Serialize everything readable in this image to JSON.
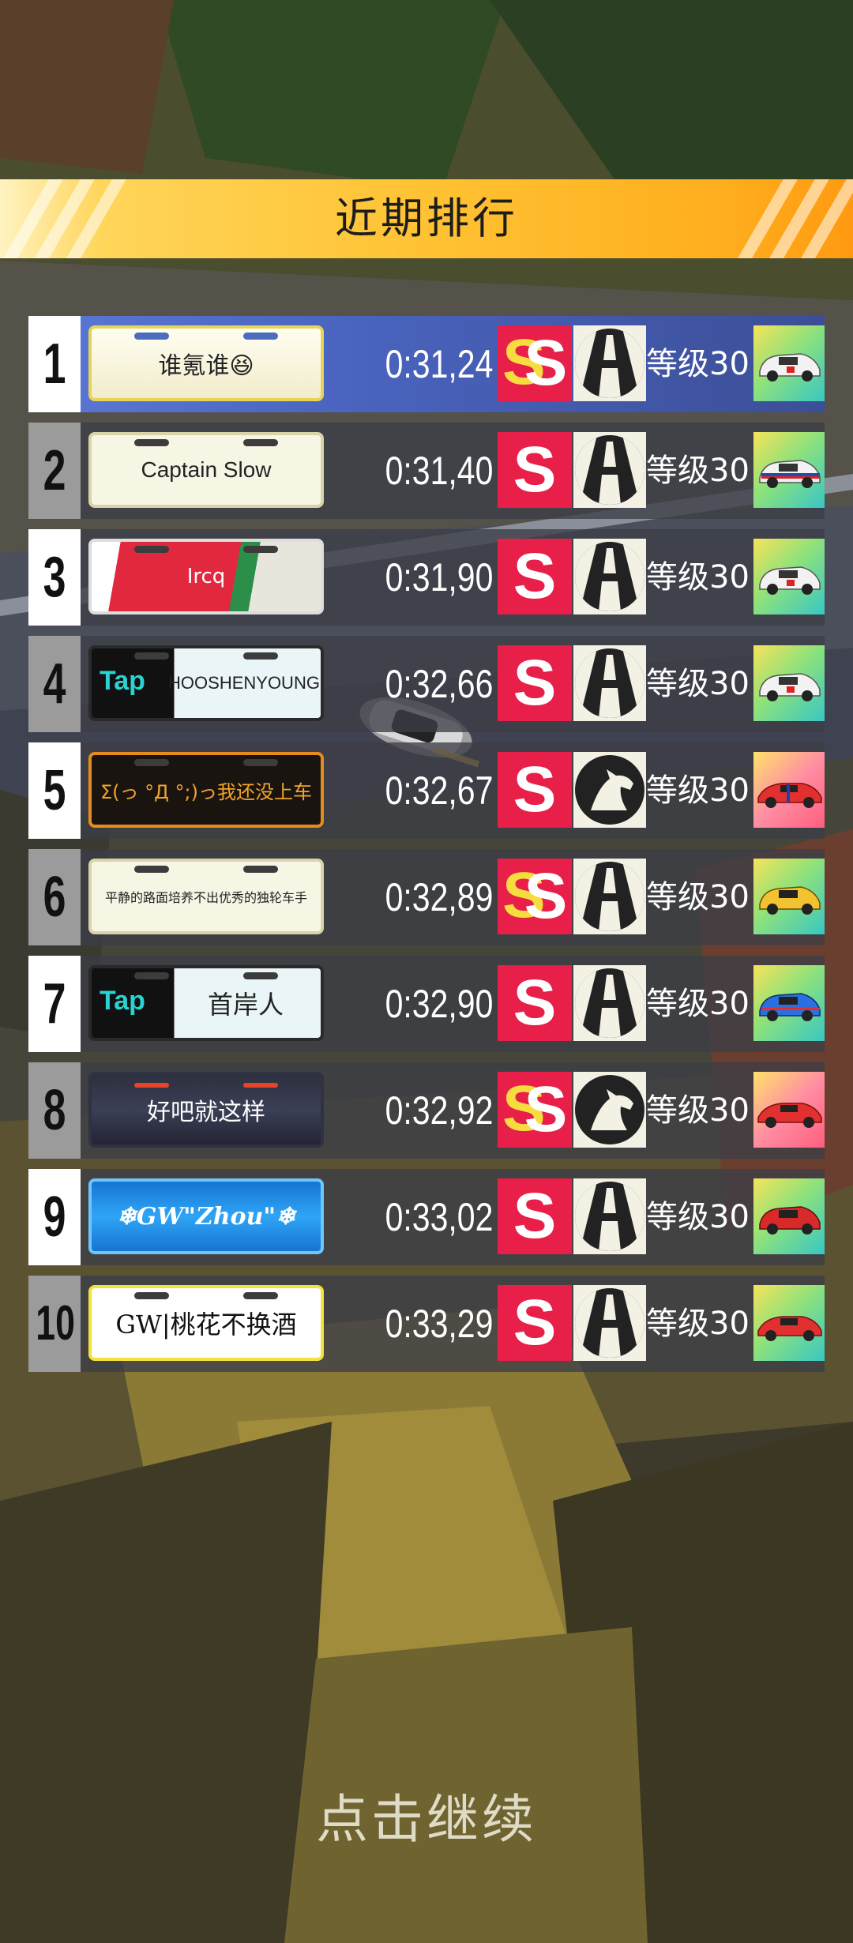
{
  "title": "近期排行",
  "continue_label": "点击继续",
  "colors": {
    "banner": "#ffc233",
    "grade_bg": "#e71f49",
    "first_row": "#4a64bf"
  },
  "rows": [
    {
      "rank": "1",
      "name": "谁氪谁😆",
      "time": "0:31,24",
      "grade": "SS",
      "track": "road-icon",
      "level": "等级30",
      "car": "white-racecar"
    },
    {
      "rank": "2",
      "name": "Captain Slow",
      "time": "0:31,40",
      "grade": "S",
      "track": "road-icon",
      "level": "等级30",
      "car": "martini-racecar"
    },
    {
      "rank": "3",
      "name": "Ircq",
      "time": "0:31,90",
      "grade": "S",
      "track": "road-icon",
      "level": "等级30",
      "car": "white-racecar"
    },
    {
      "rank": "4",
      "name": "HOOSHENYOUNG",
      "time": "0:32,66",
      "grade": "S",
      "track": "road-icon",
      "level": "等级30",
      "car": "white-racecar"
    },
    {
      "rank": "5",
      "name": "Σ(っ °Д °;)っ我还没上车",
      "time": "0:32,67",
      "grade": "S",
      "track": "horse-icon",
      "level": "等级30",
      "car": "red-sportscar"
    },
    {
      "rank": "6",
      "name": "平静的路面培养不出优秀的独轮车手",
      "time": "0:32,89",
      "grade": "SS",
      "track": "road-icon",
      "level": "等级30",
      "car": "yellow-racecar"
    },
    {
      "rank": "7",
      "name": "首岸人",
      "time": "0:32,90",
      "grade": "S",
      "track": "road-icon",
      "level": "等级30",
      "car": "blue-racecar"
    },
    {
      "rank": "8",
      "name": "好吧就这样",
      "time": "0:32,92",
      "grade": "SS",
      "track": "horse-icon",
      "level": "等级30",
      "car": "red-sportscar"
    },
    {
      "rank": "9",
      "name": "❄GW\"Zhou\"❄",
      "time": "0:33,02",
      "grade": "S",
      "track": "road-icon",
      "level": "等级30",
      "car": "red-racecar"
    },
    {
      "rank": "10",
      "name": "GW|桃花不换酒",
      "time": "0:33,29",
      "grade": "S",
      "track": "road-icon",
      "level": "等级30",
      "car": "red-sportscar"
    }
  ],
  "plate_extras": {
    "tap_label": "Tap"
  }
}
